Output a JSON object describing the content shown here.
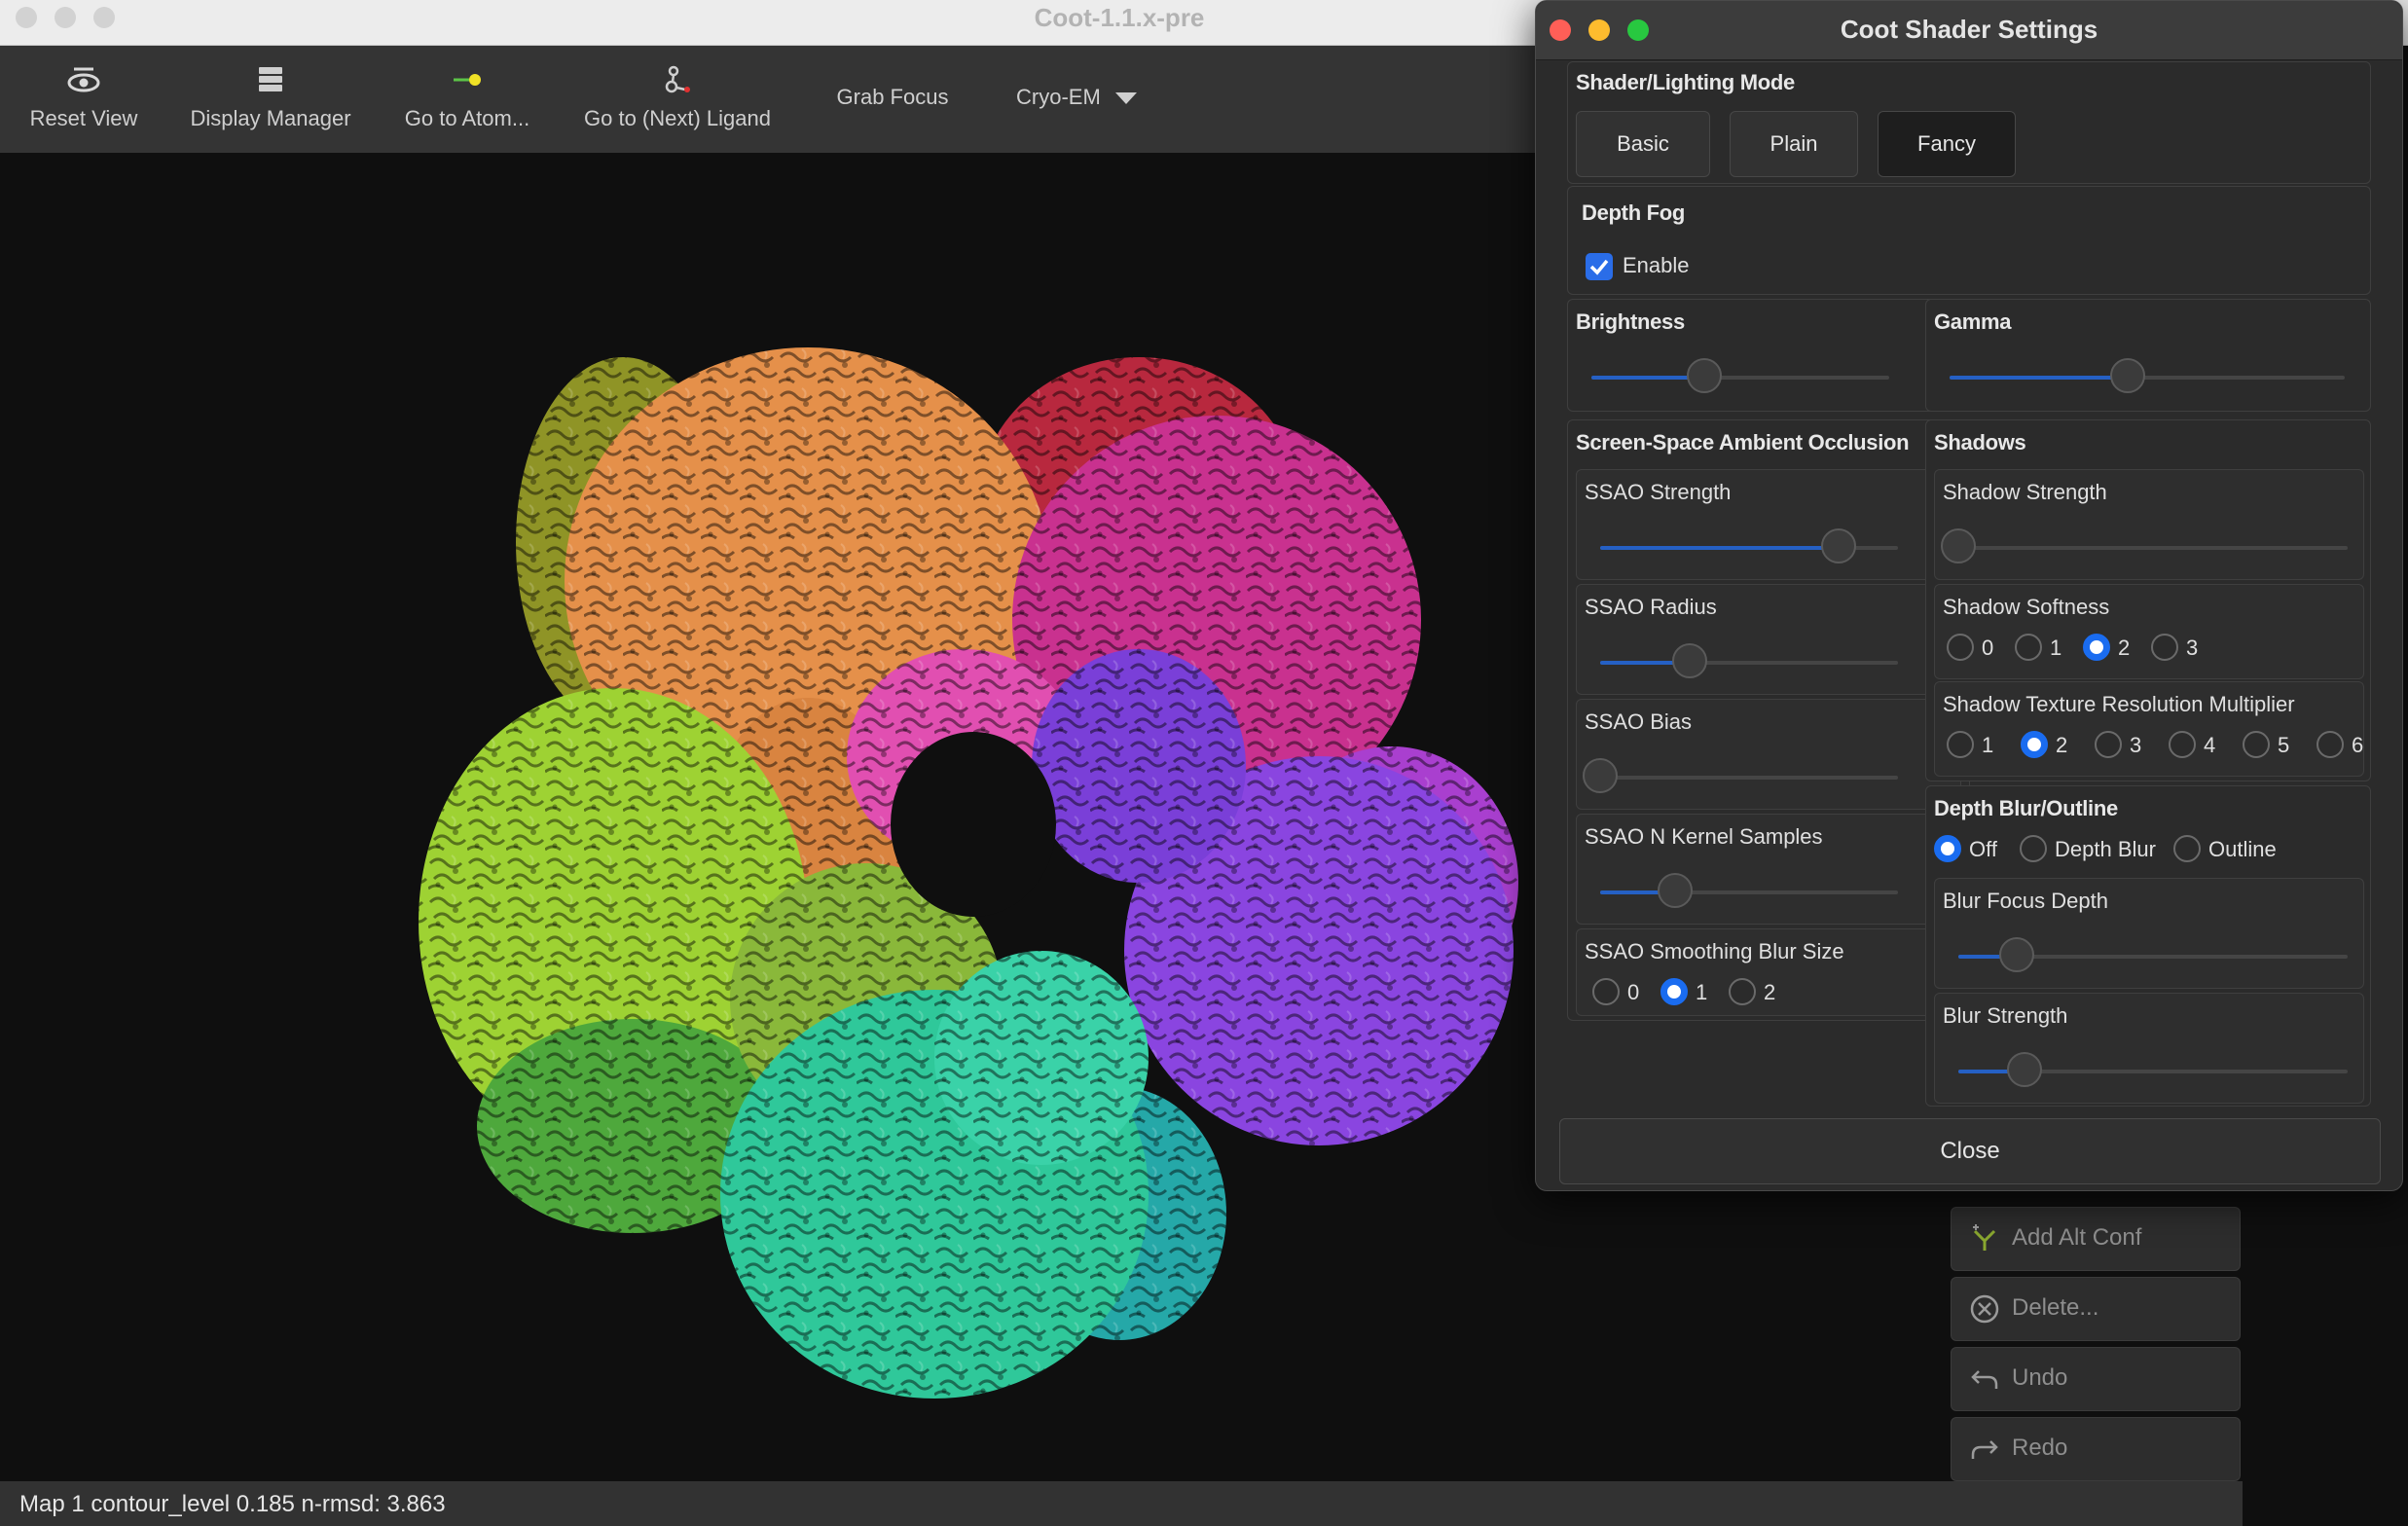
{
  "app": {
    "window_title": "Coot-1.1.x-pre",
    "status_text": "Map 1  contour_level 0.185  n-rmsd: 3.863"
  },
  "toolbar": {
    "items": [
      {
        "label": "Reset View",
        "icon": "eye-icon"
      },
      {
        "label": "Display Manager",
        "icon": "display-manager-icon"
      },
      {
        "label": "Go to Atom...",
        "icon": "atom-icon"
      },
      {
        "label": "Go to (Next) Ligand",
        "icon": "ligand-icon"
      },
      {
        "label": "Grab Focus"
      },
      {
        "label": "Cryo-EM",
        "icon": "chevron-down-icon"
      }
    ]
  },
  "side_panel": {
    "buttons": [
      {
        "label": "Add Alt Conf",
        "icon": "alt-conf-icon"
      },
      {
        "label": "Delete...",
        "icon": "delete-icon"
      },
      {
        "label": "Undo",
        "icon": "undo-icon"
      },
      {
        "label": "Redo",
        "icon": "redo-icon"
      }
    ]
  },
  "dialog": {
    "title": "Coot Shader Settings",
    "lighting": {
      "title": "Shader/Lighting Mode",
      "modes": [
        "Basic",
        "Plain",
        "Fancy"
      ],
      "selected": "Fancy"
    },
    "depth_fog": {
      "title": "Depth Fog",
      "enable_label": "Enable",
      "enabled": true
    },
    "brightness": {
      "title": "Brightness",
      "value": 0.38
    },
    "gamma": {
      "title": "Gamma",
      "value": 0.45
    },
    "ssao": {
      "title": "Screen-Space Ambient Occlusion",
      "strength": {
        "label": "SSAO Strength",
        "value": 0.8
      },
      "radius": {
        "label": "SSAO Radius",
        "value": 0.3
      },
      "bias": {
        "label": "SSAO Bias",
        "value": 0.0
      },
      "kernel": {
        "label": "SSAO N Kernel  Samples",
        "value": 0.25
      },
      "blur": {
        "label": "SSAO Smoothing Blur Size",
        "options": [
          "0",
          "1",
          "2"
        ],
        "selected": "1"
      }
    },
    "shadows": {
      "title": "Shadows",
      "strength": {
        "label": "Shadow Strength",
        "value": 0.0
      },
      "softness": {
        "label": "Shadow Softness",
        "options": [
          "0",
          "1",
          "2",
          "3"
        ],
        "selected": "2"
      },
      "texture": {
        "label": "Shadow Texture Resolution Multiplier",
        "options": [
          "1",
          "2",
          "3",
          "4",
          "5",
          "6"
        ],
        "selected": "2"
      }
    },
    "depth_blur": {
      "title": "Depth Blur/Outline",
      "options": [
        "Off",
        "Depth Blur",
        "Outline"
      ],
      "selected": "Off",
      "focus": {
        "label": "Blur Focus Depth",
        "value": 0.15
      },
      "strength": {
        "label": "Blur Strength",
        "value": 0.17
      }
    },
    "close_label": "Close"
  },
  "colors": {
    "accent": "#1a6cf0",
    "slider_fill": "#2560c4",
    "dialog_bg": "#2b2b2b",
    "viewport_bg": "#0f0f0f"
  }
}
